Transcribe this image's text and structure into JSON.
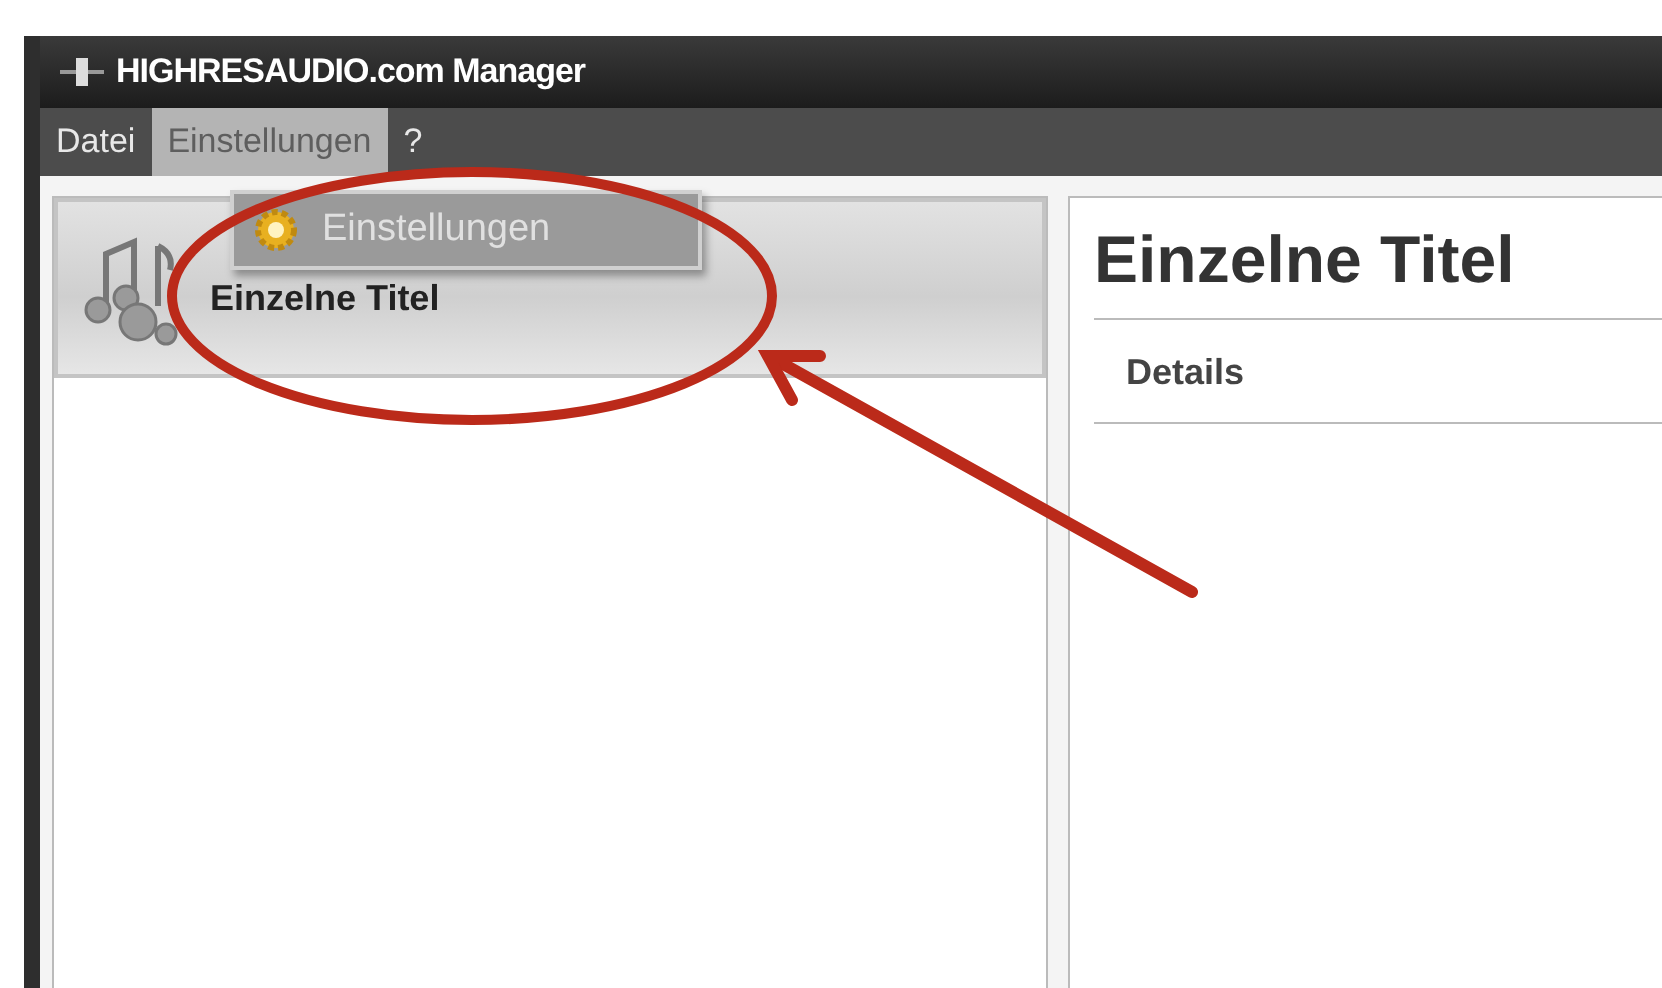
{
  "window": {
    "title": "HIGHRESAUDIO.com Manager"
  },
  "menu_bar": [
    {
      "label": "Datei",
      "selected": false
    },
    {
      "label": "Einstellungen",
      "selected": true
    },
    {
      "label": "?",
      "selected": false
    }
  ],
  "dropdown": {
    "items": [
      {
        "label": "Einstellungen"
      }
    ]
  },
  "sidebar": {
    "items": [
      {
        "label": "Einzelne Titel",
        "selected": true
      }
    ]
  },
  "main": {
    "heading": "Einzelne Titel",
    "section": "Details"
  }
}
